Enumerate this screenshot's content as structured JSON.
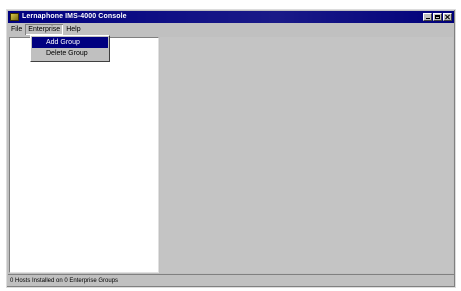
{
  "window": {
    "title": "Lernaphone IMS-4000 Console"
  },
  "menubar": {
    "items": [
      {
        "label": "File"
      },
      {
        "label": "Enterprise"
      },
      {
        "label": "Help"
      }
    ]
  },
  "dropdown": {
    "items": [
      {
        "label": "Add Group",
        "selected": true
      },
      {
        "label": "Delete Group",
        "selected": false
      }
    ]
  },
  "statusbar": {
    "text": "0 Hosts Installed on 0 Enterprise Groups"
  },
  "colors": {
    "titlebar": "#000080",
    "window_face": "#c0c0c0",
    "highlight": "#000080"
  },
  "icons": [
    "app-icon",
    "minimize-icon",
    "maximize-icon",
    "close-icon"
  ]
}
